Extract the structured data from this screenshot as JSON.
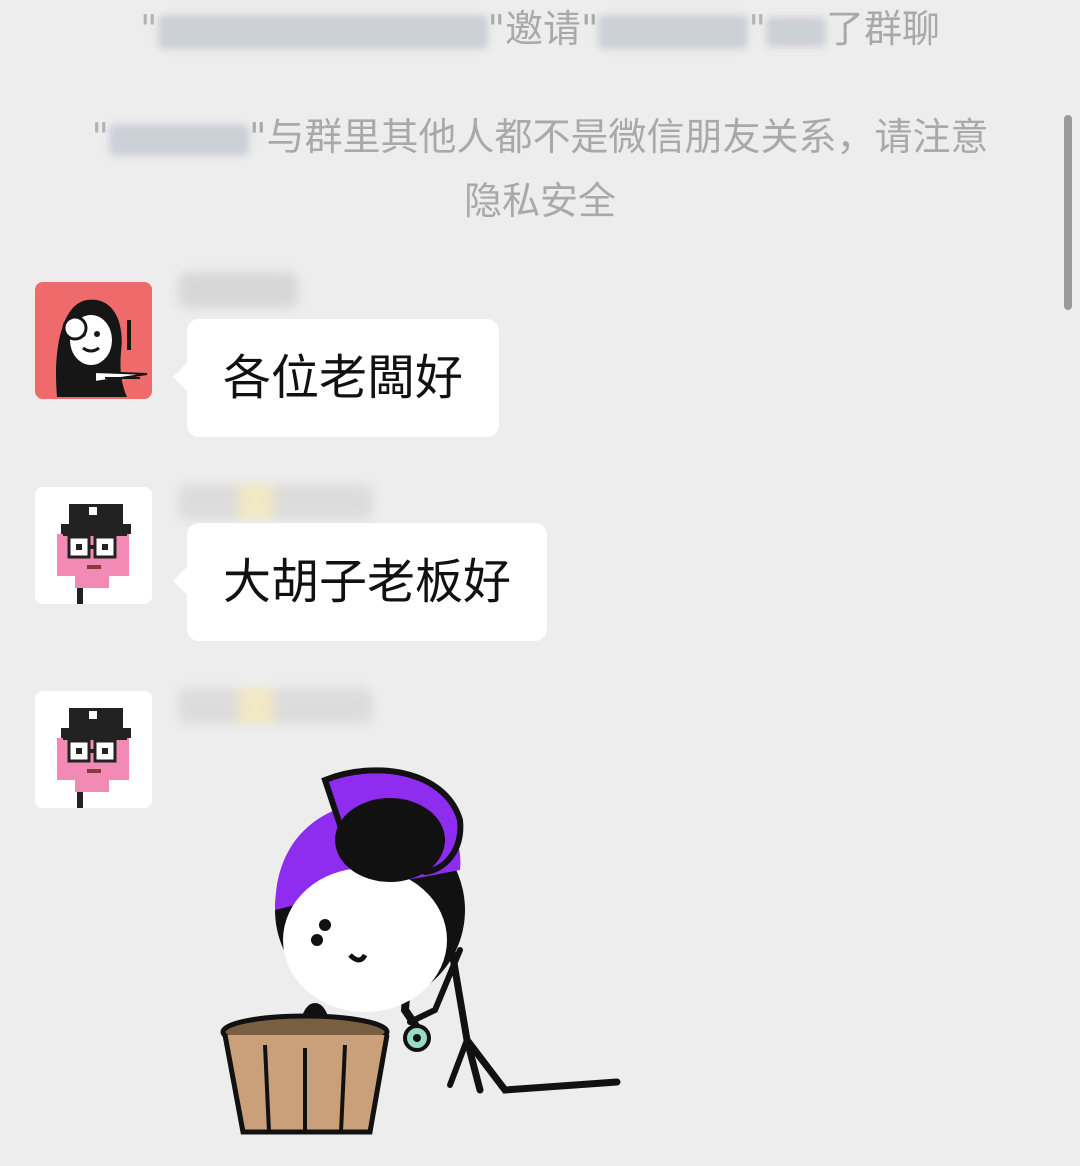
{
  "system": {
    "line1_invite_word": "\"邀请\"",
    "line1_suffix": "了群聊",
    "line2_text": "\"与群里其他人都不是微信朋友关系，请注意隐私安全"
  },
  "messages": [
    {
      "text": "各位老闆好",
      "avatar": "headphone-character-avatar"
    },
    {
      "text": "大胡子老板好",
      "avatar": "pixel-punk-avatar"
    },
    {
      "text": "",
      "avatar": "pixel-punk-avatar"
    }
  ],
  "sticker": {
    "icon": "kneeling-stick-figure-sticker"
  },
  "colors": {
    "background": "#ededed",
    "bubble": "#ffffff",
    "system_text": "#a9a9a9",
    "avatar1_bg": "#ef6b6b",
    "sticker_hair": "#8e2cf0"
  }
}
